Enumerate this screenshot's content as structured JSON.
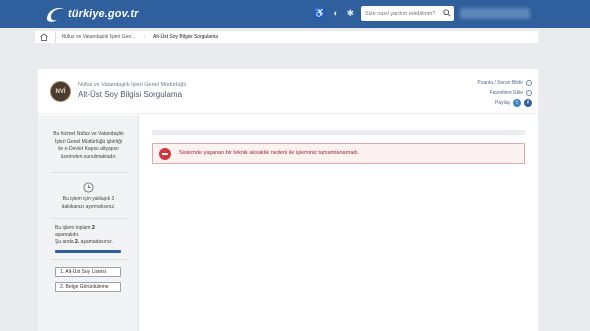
{
  "header": {
    "logo_text": "türkiye.gov.tr",
    "search_placeholder": "Size nasıl yardım edebilirim?",
    "colors": {
      "bar": "#2f5f9c",
      "accent": "#d3373e"
    }
  },
  "breadcrumb": {
    "items": [
      "Nüfus ve Vatandaşlık İşleri Gen...",
      "Alt-Üst Soy Bilgisi Sorgulama"
    ]
  },
  "service": {
    "agency": "Nüfus ve Vatandaşlık İşleri Genel Müdürlüğü",
    "title": "Alt-Üst Soy Bilgisi Sorgulama",
    "seal_label": "NVİ",
    "links": {
      "rate": "Puanla / Sorun Bildir",
      "favorite": "Favorilere Ekle",
      "share": "Paylaş"
    }
  },
  "sidebar": {
    "info": "Bu hizmet Nüfus ve Vatandaşlık İşleri Genel Müdürlüğü işbirliği ile e-Devlet Kapısı altyapısı üzerinden sunulmaktadır.",
    "duration": "Bu işlem için yaklaşık 3 dakikanızı ayırmalısınız.",
    "steps_total_prefix": "Bu işlem toplam",
    "steps_total": "2",
    "steps_total_suffix": "aşamalıdır.",
    "steps_current_prefix": "Şu anda",
    "steps_current": "2.",
    "steps_current_suffix": "aşamadasınız.",
    "progress": 1.0,
    "step_buttons": [
      "1. Alt-Üst Soy Listesi",
      "2. Belge Görüntüleme"
    ]
  },
  "main": {
    "error_message": "Sistemde yaşanan bir teknik aksaklık nedeni ile işleminiz tamamlanamadı."
  }
}
